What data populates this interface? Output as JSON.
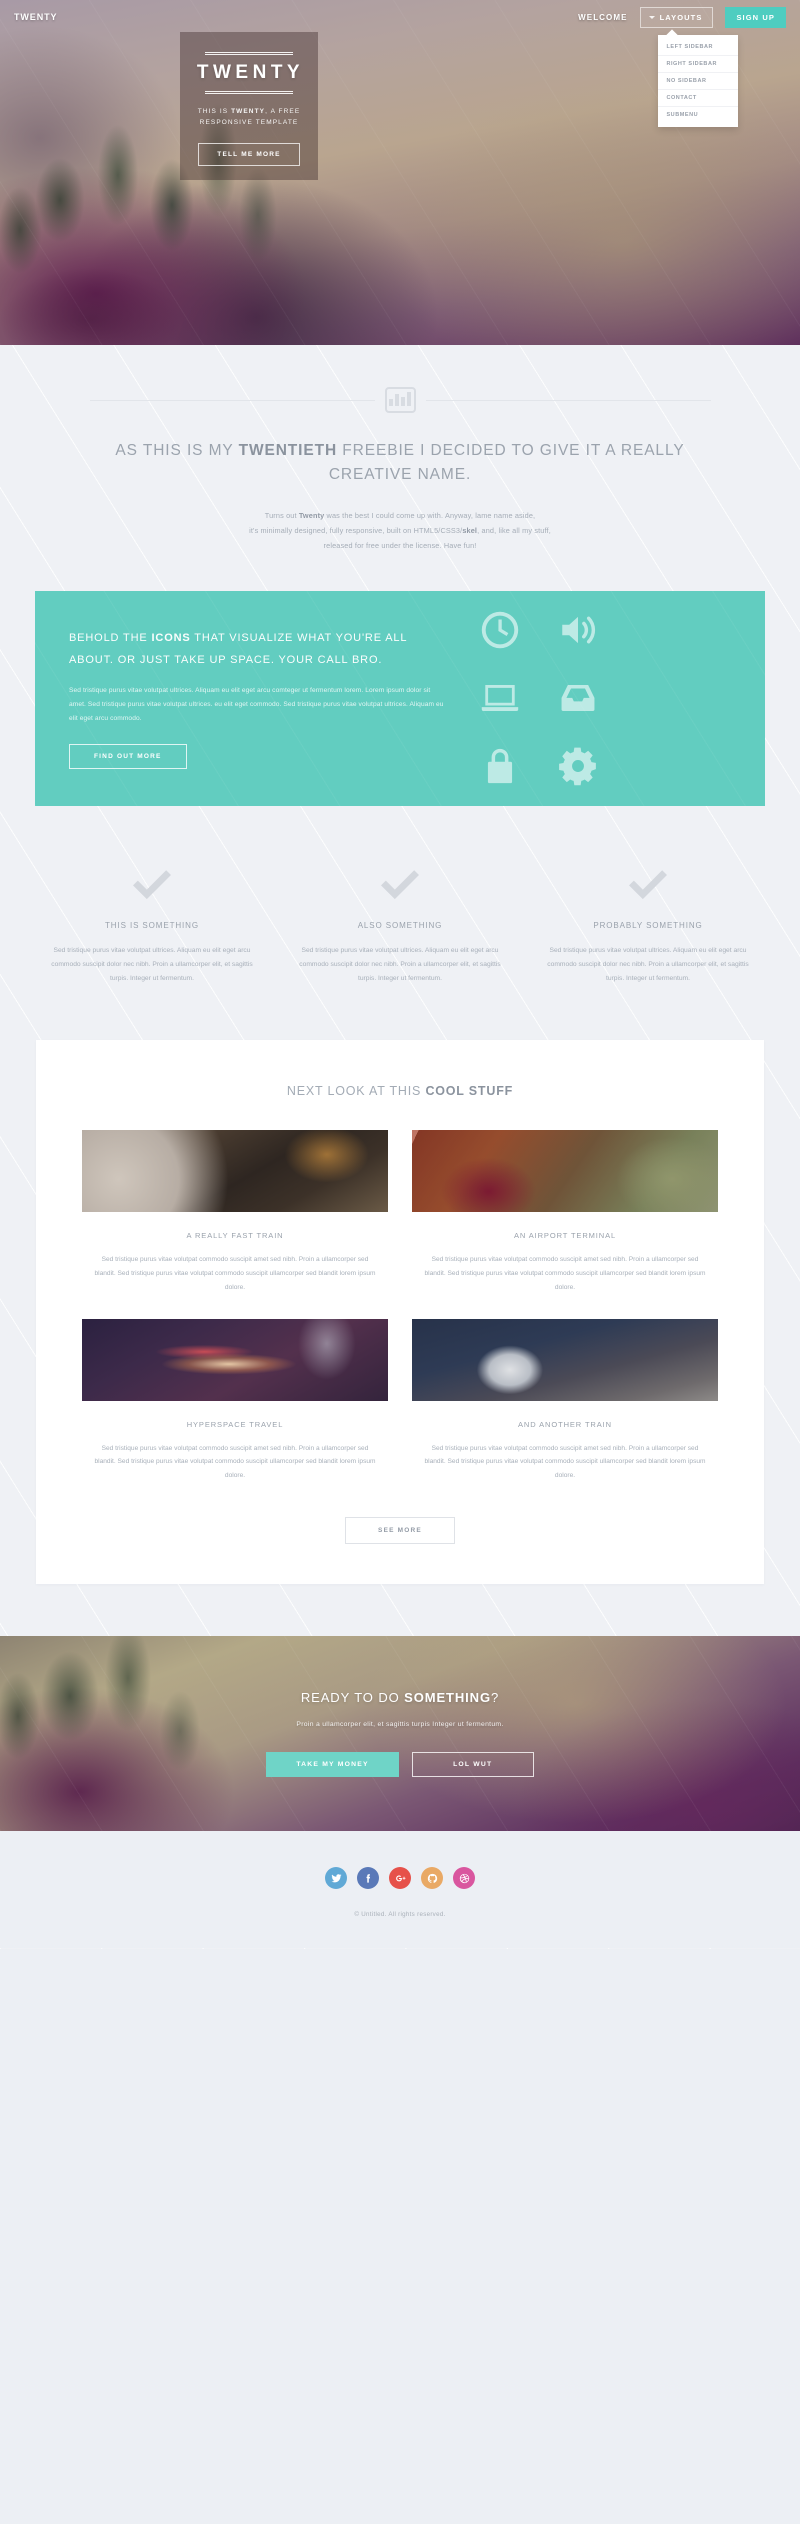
{
  "brand": {
    "name": "TWENTY",
    "accent": "#4ecdc0"
  },
  "topnav": {
    "welcome_label": "WELCOME",
    "layouts_label": "LAYOUTS",
    "signup_label": "SIGN UP",
    "dropdown_items": [
      {
        "label": "LEFT SIDEBAR"
      },
      {
        "label": "RIGHT SIDEBAR"
      },
      {
        "label": "NO SIDEBAR"
      },
      {
        "label": "CONTACT"
      },
      {
        "label": "SUBMENU"
      }
    ]
  },
  "hero": {
    "title": "TWENTY",
    "subtitle_pre": "THIS IS ",
    "subtitle_strong": "TWENTY",
    "subtitle_post": ", A FREE RESPONSIVE TEMPLATE",
    "button": "TELL ME MORE"
  },
  "intro": {
    "icon": "bar-chart-icon",
    "heading_pre": "AS THIS IS MY ",
    "heading_strong": "TWENTIETH",
    "heading_post": " FREEBIE I DECIDED TO GIVE IT A REALLY CREATIVE NAME.",
    "body_line1_pre": "Turns out ",
    "body_line1_strong": "Twenty",
    "body_line1_post": " was the best I could come up with. Anyway, lame name aside,",
    "body_line2_pre": "it's minimally designed, fully responsive, built on HTML5/CSS3/",
    "body_line2_strong": "skel",
    "body_line2_post": ", and, like all my stuff,",
    "body_line3": "released for free under the license. Have fun!"
  },
  "teal": {
    "bg": "#62cdc0",
    "heading_pre": "BEHOLD THE ",
    "heading_strong": "ICONS",
    "heading_post": " THAT VISUALIZE WHAT YOU'RE ALL ABOUT. OR JUST TAKE UP SPACE. YOUR CALL BRO.",
    "body": "Sed tristique purus vitae volutpat ultrices. Aliquam eu elit eget arcu comteger ut fermentum lorem. Lorem ipsum dolor sit amet. Sed tristique purus vitae volutpat ultrices. eu elit eget commodo. Sed tristique purus vitae volutpat ultrices. Aliquam eu elit eget arcu commodo.",
    "button": "FIND OUT MORE",
    "icons": [
      "clock-icon",
      "volume-icon",
      "laptop-icon",
      "inbox-icon",
      "lock-icon",
      "gear-icon"
    ]
  },
  "features": [
    {
      "icon": "check-icon",
      "title": "THIS IS SOMETHING",
      "body": "Sed tristique purus vitae volutpat ultrices. Aliquam eu elit eget arcu commodo suscipit dolor nec nibh. Proin a ullamcorper elit, et sagittis turpis. Integer ut fermentum."
    },
    {
      "icon": "check-icon",
      "title": "ALSO SOMETHING",
      "body": "Sed tristique purus vitae volutpat ultrices. Aliquam eu elit eget arcu commodo suscipit dolor nec nibh. Proin a ullamcorper elit, et sagittis turpis. Integer ut fermentum."
    },
    {
      "icon": "check-icon",
      "title": "PROBABLY SOMETHING",
      "body": "Sed tristique purus vitae volutpat ultrices. Aliquam eu elit eget arcu commodo suscipit dolor nec nibh. Proin a ullamcorper elit, et sagittis turpis. Integer ut fermentum."
    }
  ],
  "gallery": {
    "heading_pre": "NEXT LOOK AT THIS ",
    "heading_strong": "COOL STUFF",
    "see_more": "SEE MORE",
    "items": [
      {
        "title": "A REALLY FAST TRAIN",
        "body": "Sed tristique purus vitae volutpat commodo suscipit amet sed nibh. Proin a ullamcorper sed blandit. Sed tristique purus vitae volutpat commodo suscipit ullamcorper sed blandit lorem ipsum dolore."
      },
      {
        "title": "AN AIRPORT TERMINAL",
        "body": "Sed tristique purus vitae volutpat commodo suscipit amet sed nibh. Proin a ullamcorper sed blandit. Sed tristique purus vitae volutpat commodo suscipit ullamcorper sed blandit lorem ipsum dolore."
      },
      {
        "title": "HYPERSPACE TRAVEL",
        "body": "Sed tristique purus vitae volutpat commodo suscipit amet sed nibh. Proin a ullamcorper sed blandit. Sed tristique purus vitae volutpat commodo suscipit ullamcorper sed blandit lorem ipsum dolore."
      },
      {
        "title": "AND ANOTHER TRAIN",
        "body": "Sed tristique purus vitae volutpat commodo suscipit amet sed nibh. Proin a ullamcorper sed blandit. Sed tristique purus vitae volutpat commodo suscipit ullamcorper sed blandit lorem ipsum dolore."
      }
    ]
  },
  "cta": {
    "heading_pre": "READY TO DO ",
    "heading_strong": "SOMETHING",
    "heading_post": "?",
    "subtitle": "Proin a ullamcorper elit, et sagittis turpis Integer ut fermentum.",
    "primary_button": "TAKE MY MONEY",
    "ghost_button": "LOL WUT"
  },
  "footer": {
    "socials": [
      {
        "name": "twitter-icon",
        "color": "#60a9d6"
      },
      {
        "name": "facebook-icon",
        "color": "#5a79b8"
      },
      {
        "name": "google-plus-icon",
        "color": "#e6514a"
      },
      {
        "name": "github-icon",
        "color": "#e9a965"
      },
      {
        "name": "dribbble-icon",
        "color": "#d9569f"
      }
    ],
    "copyright": "© Untitled. All rights reserved."
  }
}
